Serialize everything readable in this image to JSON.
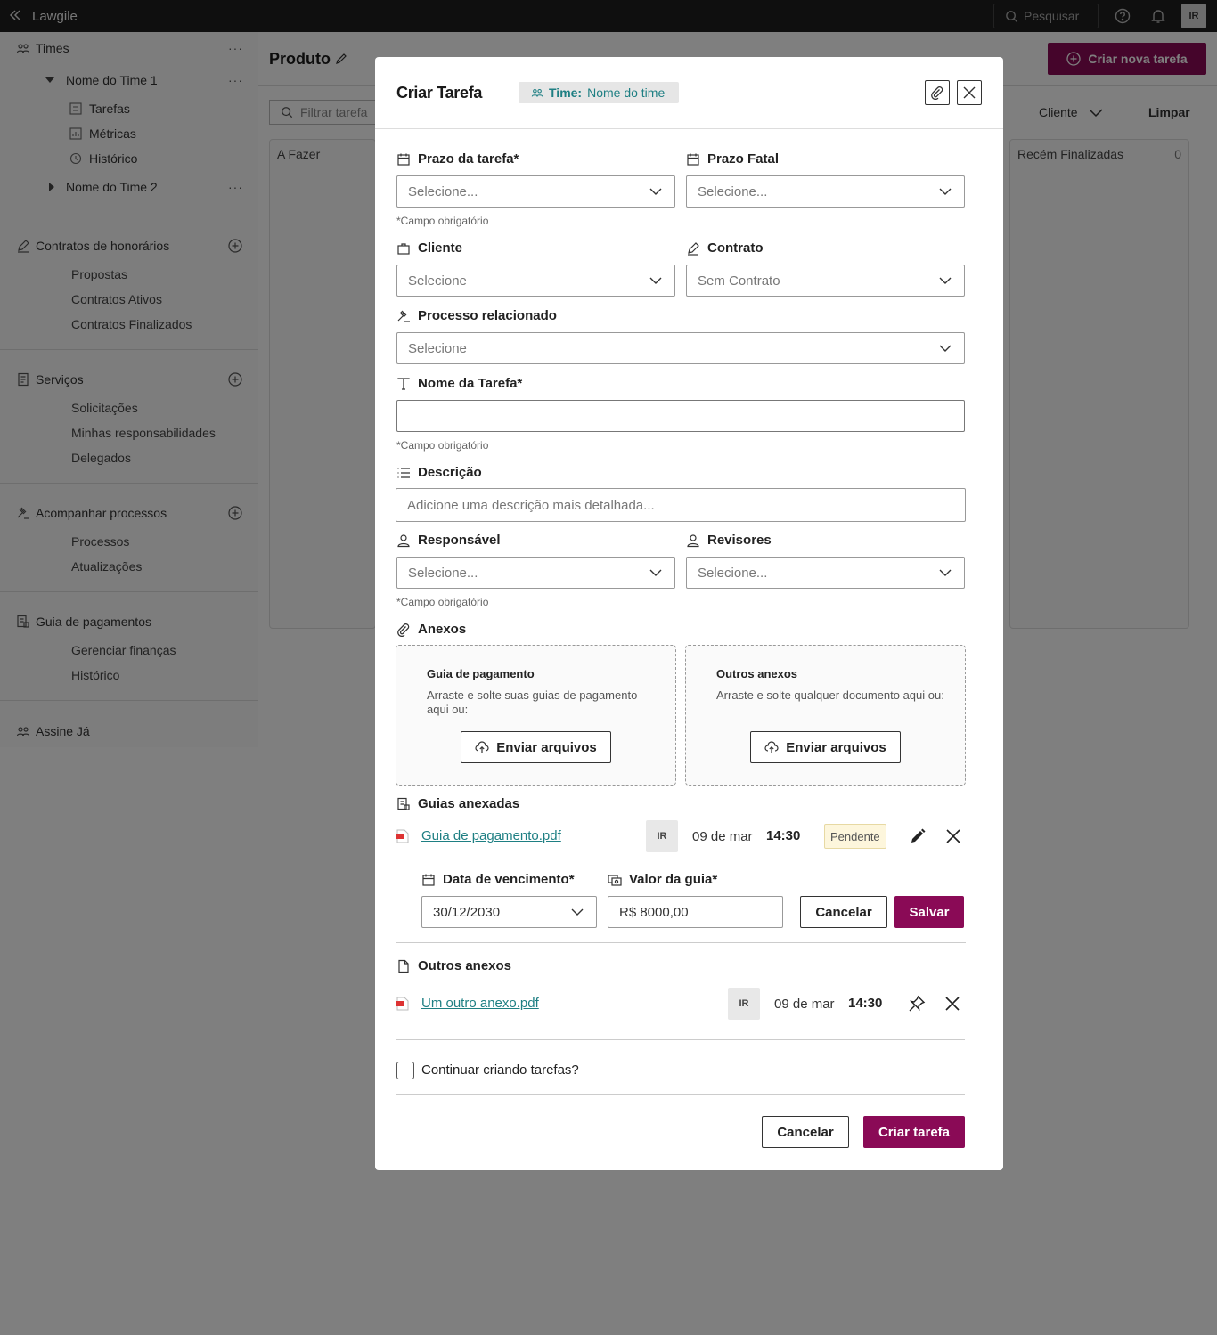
{
  "app": {
    "name": "Lawgile"
  },
  "topbar": {
    "search_label": "Pesquisar",
    "avatar_initials": "IR"
  },
  "sidebar": {
    "times_label": "Times",
    "team1_label": "Nome do Time 1",
    "team1_items": [
      "Tarefas",
      "Métricas",
      "Histórico"
    ],
    "team2_label": "Nome do Time 2",
    "contratos_label": "Contratos de honorários",
    "contratos_items": [
      "Propostas",
      "Contratos Ativos",
      "Contratos Finalizados"
    ],
    "servicos_label": "Serviços",
    "servicos_items": [
      "Solicitações",
      "Minhas responsabilidades",
      "Delegados"
    ],
    "processos_label": "Acompanhar processos",
    "processos_items": [
      "Processos",
      "Atualizações"
    ],
    "pagamentos_label": "Guia de pagamentos",
    "pagamentos_items": [
      "Gerenciar finanças",
      "Histórico"
    ],
    "assine_label": "Assine Já"
  },
  "main": {
    "title": "Produto",
    "new_task_label": "Criar nova tarefa",
    "filter_placeholder": "Filtrar tarefa",
    "cliente_label": "Cliente",
    "limpar_label": "Limpar",
    "col_todo": "A Fazer",
    "col_done": "Recém Finalizadas",
    "col_done_count": "0"
  },
  "modal": {
    "title": "Criar Tarefa",
    "team_chip_key": "Time:",
    "team_chip_value": "Nome do time",
    "prazo_label": "Prazo da tarefa*",
    "prazo_placeholder": "Selecione...",
    "prazo_fatal_label": "Prazo Fatal",
    "prazo_fatal_placeholder": "Selecione...",
    "required_note": "*Campo obrigatório",
    "cliente_label": "Cliente",
    "cliente_value": "Selecione",
    "contrato_label": "Contrato",
    "contrato_value": "Sem Contrato",
    "processo_label": "Processo relacionado",
    "processo_value": "Selecione",
    "nome_label": "Nome da Tarefa*",
    "nome_value": "",
    "descricao_label": "Descrição",
    "descricao_placeholder": "Adicione uma descrição mais detalhada...",
    "responsavel_label": "Responsável",
    "responsavel_placeholder": "Selecione...",
    "revisores_label": "Revisores",
    "revisores_placeholder": "Selecione...",
    "anexos_label": "Anexos",
    "drop_guia_title": "Guia de pagamento",
    "drop_guia_desc": "Arraste e solte suas guias de pagamento aqui ou:",
    "drop_outros_title": "Outros anexos",
    "drop_outros_desc": "Arraste e solte qualquer documento aqui ou:",
    "upload_label": "Enviar arquivos",
    "guias_label": "Guias anexadas",
    "guia_file": "Guia de pagamento.pdf",
    "guia_initials": "IR",
    "guia_date": "09 de mar",
    "guia_time": "14:30",
    "guia_status": "Pendente",
    "vencimento_label": "Data de vencimento*",
    "vencimento_value": "30/12/2030",
    "valor_label": "Valor da guia*",
    "valor_value": "R$ 8000,00",
    "cancel_label": "Cancelar",
    "save_label": "Salvar",
    "outros_label": "Outros anexos",
    "outro_file": "Um outro anexo.pdf",
    "outro_initials": "IR",
    "outro_date": "09 de mar",
    "outro_time": "14:30",
    "continuar_label": "Continuar criando tarefas?",
    "footer_cancel": "Cancelar",
    "footer_create": "Criar tarefa"
  },
  "colors": {
    "accent": "#8a0a56",
    "link": "#1e7f83",
    "overlay": "rgba(0,0,0,0.5)"
  }
}
